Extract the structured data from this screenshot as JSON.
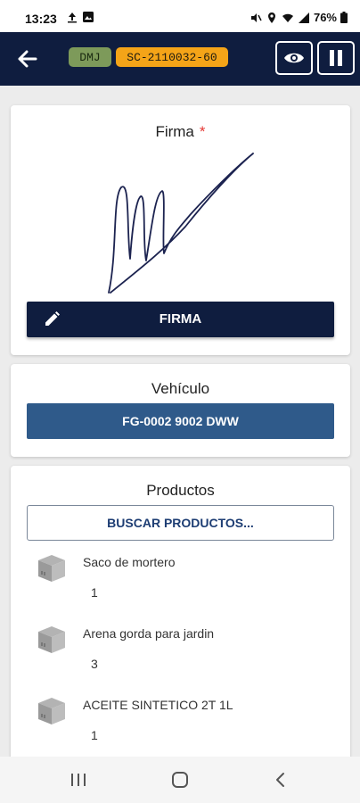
{
  "status_bar": {
    "time": "13:23",
    "battery": "76%",
    "icons": [
      "upload-icon",
      "image-icon",
      "mute-icon",
      "location-icon",
      "wifi-icon",
      "signal-icon",
      "battery-icon"
    ]
  },
  "app_bar": {
    "back_icon": "arrow-left-icon",
    "tag_short": "DMJ",
    "tag_code": "SC-2110032-60",
    "eye_icon": "eye-icon",
    "pause_icon": "pause-icon"
  },
  "signature_card": {
    "title": "Firma",
    "required_mark": "*",
    "button_label": "FIRMA",
    "button_icon": "pencil-icon"
  },
  "vehicle_card": {
    "title": "Vehículo",
    "vehicle_label": "FG-0002 9002 DWW"
  },
  "products_card": {
    "title": "Productos",
    "search_label": "BUSCAR PRODUCTOS...",
    "items": [
      {
        "name": "Saco de mortero",
        "qty": "1",
        "icon": "box-icon"
      },
      {
        "name": "Arena gorda para jardin",
        "qty": "3",
        "icon": "box-icon"
      },
      {
        "name": "ACEITE SINTETICO 2T 1L",
        "qty": "1",
        "icon": "box-icon"
      }
    ]
  },
  "nav_bar": {
    "items": [
      "recent-apps-icon",
      "home-icon",
      "back-icon"
    ]
  },
  "colors": {
    "app_bar": "#0f1d3f",
    "vehicle_button": "#2f5a8a",
    "tag_short": "#7d9a5a",
    "tag_code": "#f4a418",
    "required": "#e53935"
  }
}
